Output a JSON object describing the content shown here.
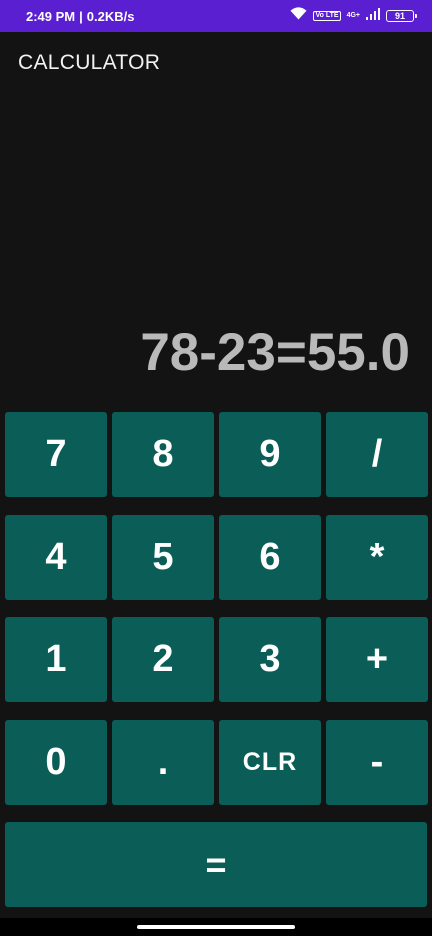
{
  "status_bar": {
    "time": "2:49 PM",
    "separator": "|",
    "net_speed": "0.2KB/s",
    "volte_label": "Vo LTE",
    "network_label": "4G+",
    "battery_level": "91",
    "icons": [
      "wifi-icon",
      "signal-icon",
      "battery-icon"
    ]
  },
  "app": {
    "title": "CALCULATOR"
  },
  "display": {
    "expression": "78-23=55.0"
  },
  "keypad": {
    "keys": [
      "7",
      "8",
      "9",
      "/",
      "4",
      "5",
      "6",
      "*",
      "1",
      "2",
      "3",
      "+",
      "0",
      ".",
      "CLR",
      "-"
    ],
    "equals": "="
  },
  "colors": {
    "status_bar": "#5a1fd0",
    "background": "#131313",
    "key_background": "#0b5e58",
    "display_text": "#b9b9b9"
  }
}
